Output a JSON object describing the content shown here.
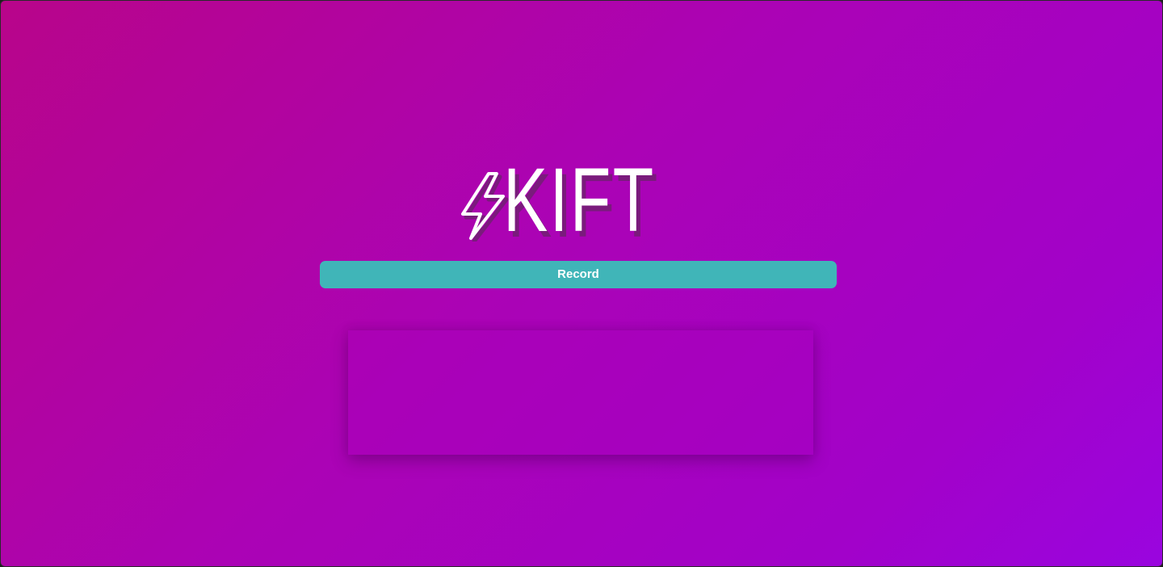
{
  "app": {
    "title": "KIFT",
    "logo_icon": "lightning-bolt-icon",
    "background_gradient": [
      "#b8058a",
      "#9a05df"
    ],
    "accent_color": "#40b5b8"
  },
  "controls": {
    "record_label": "Record"
  },
  "output": {
    "text": ""
  }
}
